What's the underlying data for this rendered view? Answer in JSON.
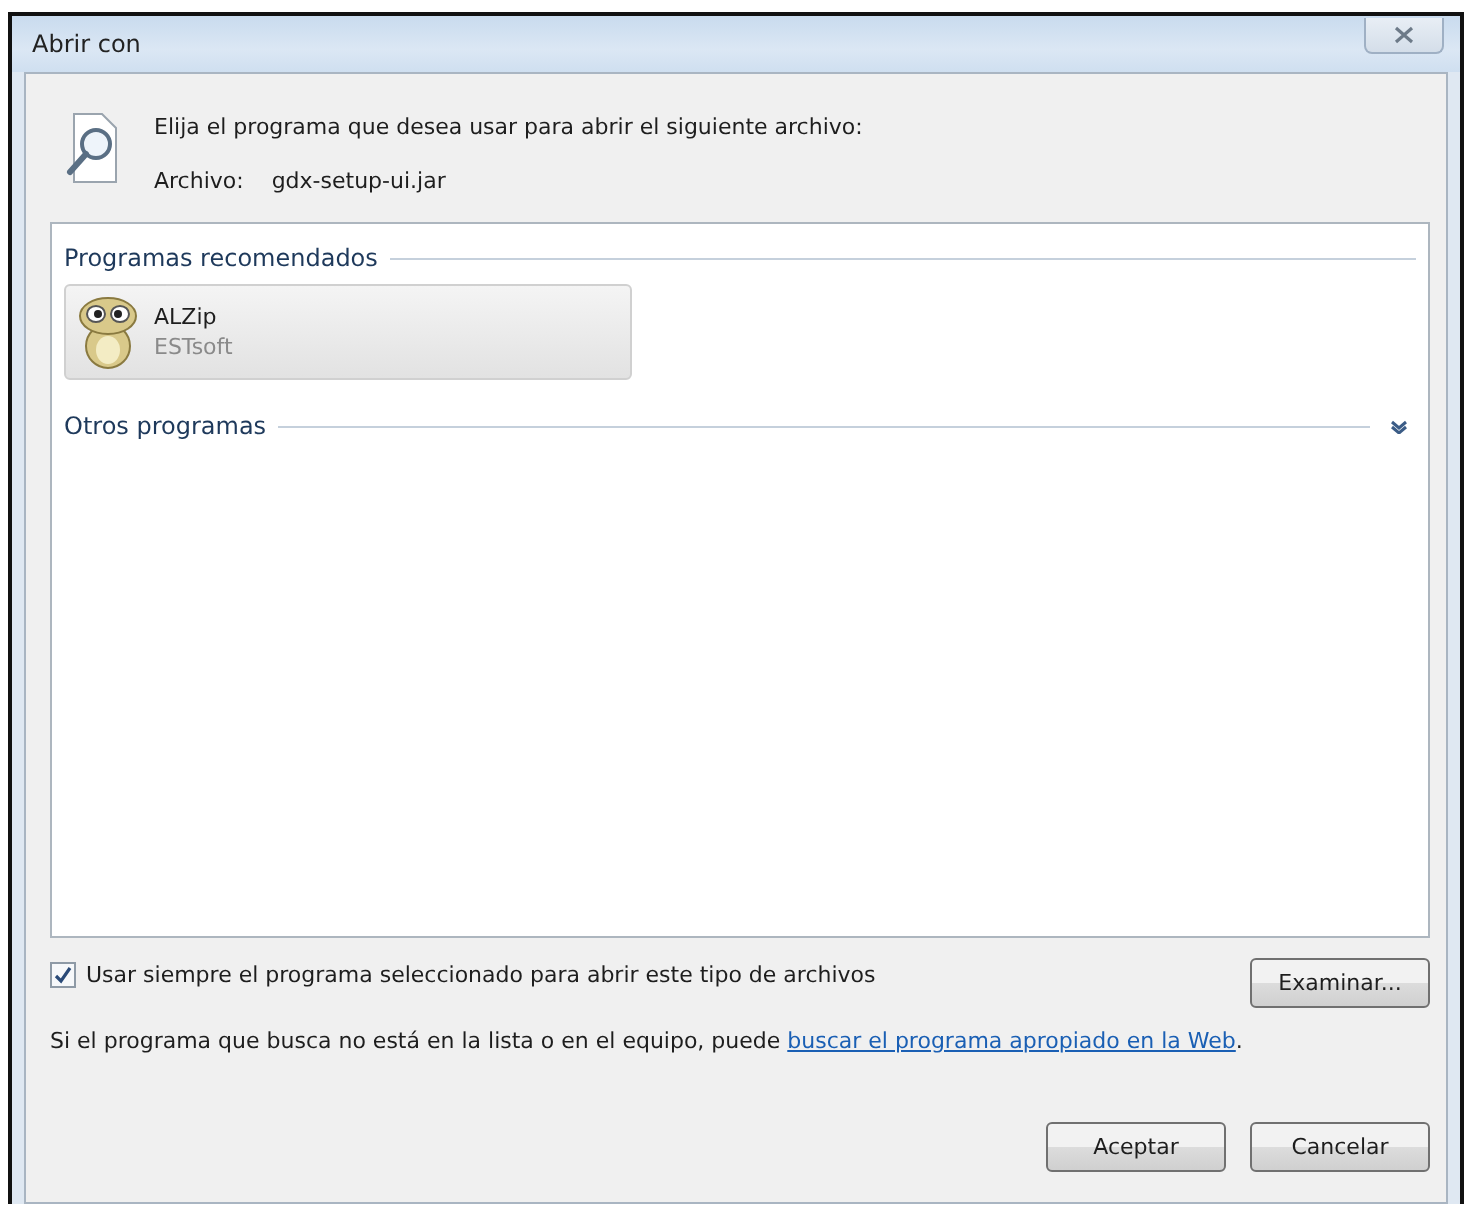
{
  "window": {
    "title": "Abrir con"
  },
  "prompt": "Elija el programa que desea usar para abrir el siguiente archivo:",
  "file": {
    "label": "Archivo:",
    "name": "gdx-setup-ui.jar"
  },
  "groups": [
    {
      "title": "Programas recomendados",
      "expanded": true,
      "programs": [
        {
          "name": "ALZip",
          "publisher": "ESTsoft",
          "selected": true
        }
      ]
    },
    {
      "title": "Otros programas",
      "expanded": false
    }
  ],
  "always_use": {
    "label": "Usar siempre el programa seleccionado para abrir este tipo de archivos",
    "checked": true
  },
  "browse_button": "Examinar...",
  "note": {
    "text": "Si el programa que busca no está en la lista o en el equipo, puede ",
    "link": "buscar el programa apropiado en la Web",
    "after": "."
  },
  "buttons": [
    "Aceptar",
    "Cancelar"
  ]
}
